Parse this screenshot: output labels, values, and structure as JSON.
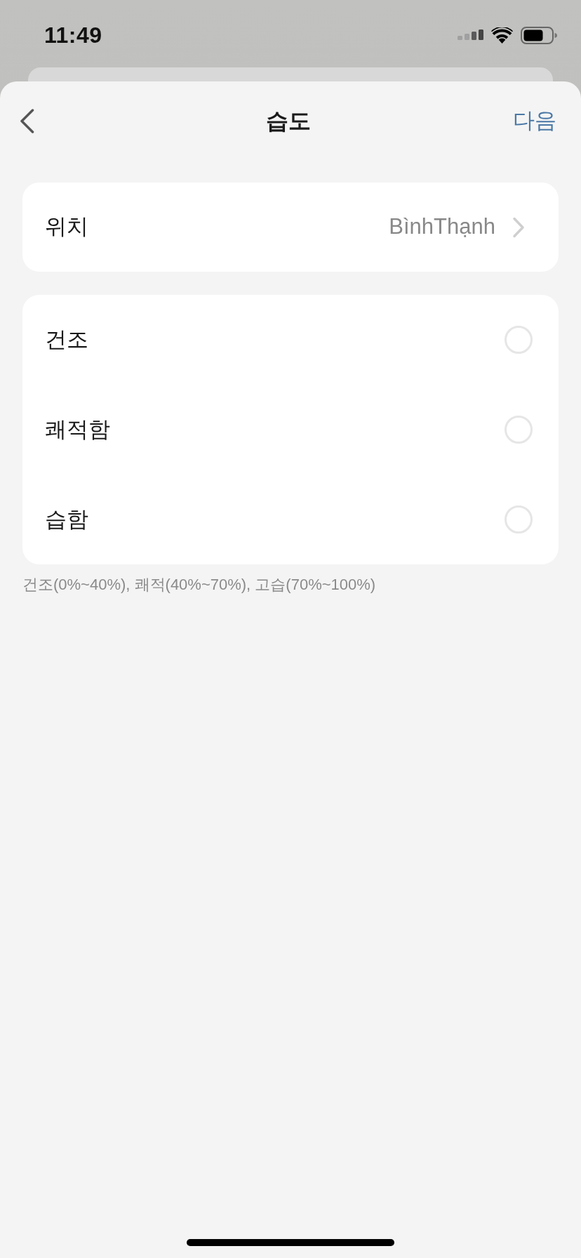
{
  "status_bar": {
    "time": "11:49"
  },
  "header": {
    "title": "습도",
    "next": "다음"
  },
  "location": {
    "label": "위치",
    "value": "BìnhThạnh"
  },
  "options": [
    {
      "label": "건조",
      "selected": false
    },
    {
      "label": "쾌적함",
      "selected": false
    },
    {
      "label": "습함",
      "selected": false
    }
  ],
  "note": "건조(0%~40%), 쾌적(40%~70%), 고습(70%~100%)"
}
